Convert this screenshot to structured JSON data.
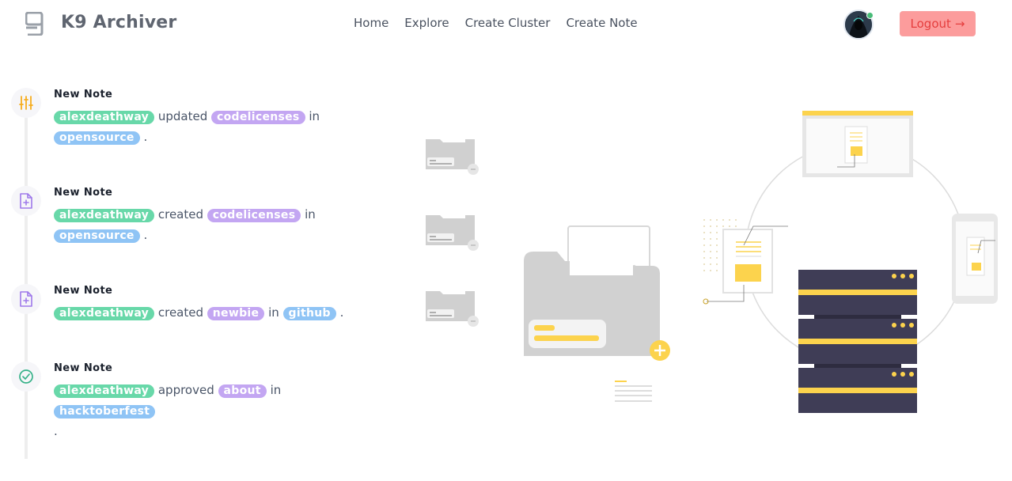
{
  "header": {
    "brand": "K9 Archiver",
    "nav": [
      "Home",
      "Explore",
      "Create Cluster",
      "Create Note"
    ],
    "logout_label": "Logout",
    "logout_arrow": "→"
  },
  "colors": {
    "user_pill": "#68d8a9",
    "note_pill": "#c3a6f2",
    "cluster_pill": "#8fc4f5",
    "logout_bg": "#fc9c9c",
    "accent_yellow": "#fcd34d"
  },
  "timeline": [
    {
      "icon": "sliders-icon",
      "title": "New Note",
      "user": "alexdeathway",
      "verb": "updated",
      "note": "codelicenses",
      "prep": "in",
      "cluster": "opensource",
      "end": "."
    },
    {
      "icon": "file-plus-icon",
      "title": "New Note",
      "user": "alexdeathway",
      "verb": "created",
      "note": "codelicenses",
      "prep": "in",
      "cluster": "opensource",
      "end": "."
    },
    {
      "icon": "file-plus-icon",
      "title": "New Note",
      "user": "alexdeathway",
      "verb": "created",
      "note": "newbie",
      "prep": "in",
      "cluster": "github",
      "end": "."
    },
    {
      "icon": "check-circle-icon",
      "title": "New Note",
      "user": "alexdeathway",
      "verb": "approved",
      "note": "about",
      "prep": "in",
      "cluster": "hacktoberfest",
      "end": "."
    }
  ]
}
